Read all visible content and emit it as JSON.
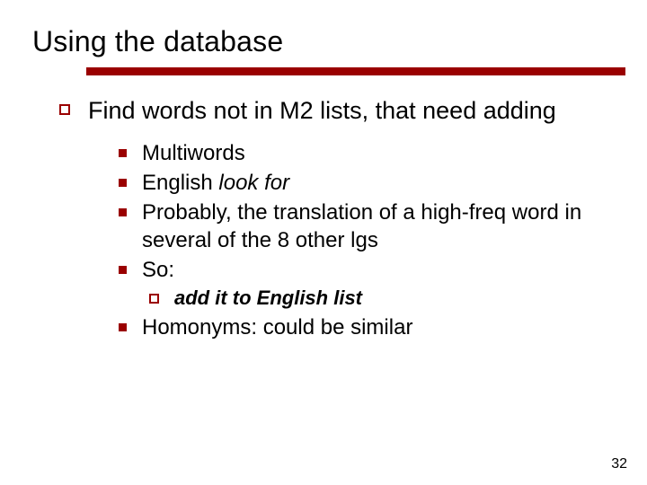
{
  "title": "Using the database",
  "level1": {
    "text": "Find words not in M2 lists, that need adding"
  },
  "level2": {
    "items": [
      {
        "text": "Multiwords"
      },
      {
        "prefix": "English ",
        "italic": "look for"
      },
      {
        "text": "Probably, the translation of a high-freq word in several of the 8 other lgs"
      },
      {
        "text": "So:"
      },
      {
        "text": "Homonyms: could be similar"
      }
    ]
  },
  "level3": {
    "item": {
      "text": "add it to English list"
    }
  },
  "pageNumber": "32"
}
